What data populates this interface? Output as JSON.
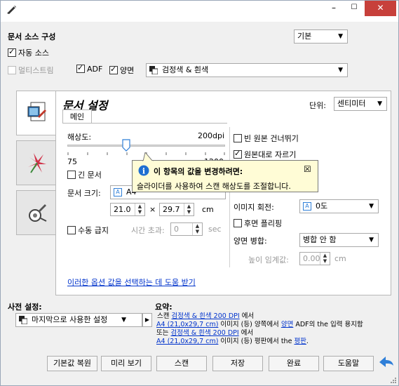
{
  "title": {
    "min": "–",
    "max": "☐",
    "close": "✕"
  },
  "source": {
    "heading": "문서 소스 구성",
    "preset_value": "기본",
    "auto_source": "자동 소스",
    "multistream": "멀티스트림",
    "adf": "ADF",
    "duplex": "양면",
    "color_mode": "검정색 & 흰색"
  },
  "doc": {
    "title": "문서 설정",
    "units_label": "단위:",
    "units_value": "센티미터",
    "tab_main": "메인",
    "resolution_label": "해상도:",
    "resolution_value": "200dpi",
    "slider_min": "75",
    "slider_max": "1200",
    "long_doc": "긴 문서",
    "doc_size_label": "문서 크기:",
    "doc_size_value": "A4",
    "width": "21.0",
    "times": "×",
    "height": "29.7",
    "size_unit": "cm",
    "manual_feed": "수동 급지",
    "timeout_label": "시간 초과:",
    "timeout_value": "0",
    "timeout_unit": "sec",
    "skip_blank": "빈 원본 건너뛰기",
    "crop_original": "원본대로 자르기",
    "rotate_label": "이미지 회전:",
    "rotate_value": "0도",
    "flip_back": "후면 플리핑",
    "duplex_merge_label": "양면 병합:",
    "duplex_merge_value": "병합 안 함",
    "height_threshold_label": "높이 임계값:",
    "height_threshold_value": "0.00",
    "height_threshold_unit": "cm",
    "help_link": "이러한 옵션 값을 선택하는 데 도움 받기"
  },
  "tooltip": {
    "title": "이 항목의 값을 변경하려면:",
    "body": "슬라이더를 사용하여 스캔 해상도를 조절합니다."
  },
  "presets": {
    "label": "사전 설정:",
    "value": "마지막으로 사용한 설정"
  },
  "summary": {
    "label": "요약:",
    "l1a": "스캔 ",
    "l1b": "검정색 & 흰색 200 DPI",
    "l1c": " 에서",
    "l2a": "A4 (21,0x29,7 cm)",
    "l2b": " 이미지 (등) 양쪽에서 ",
    "l2c": "양면",
    "l2d": " ADF의 the 입력 용지함",
    "l3a": " 또는 ",
    "l3b": "검정색 & 흰색 200 DPI",
    "l3c": " 에서",
    "l4a": "A4 (21,0x29,7 cm)",
    "l4b": " 이미지 (등) 평판에서 the ",
    "l4c": "평판",
    "l4d": "."
  },
  "buttons": {
    "reset": "기본값 복원",
    "preview": "미리 보기",
    "scan": "스캔",
    "save": "저장",
    "done": "완료",
    "help": "도움말"
  },
  "colors": {
    "link": "#0033cc",
    "close": "#c7403b",
    "tooltip_bg": "#fffcd6",
    "info": "#1f6fd1",
    "back_arrow": "#2f7fd8"
  }
}
